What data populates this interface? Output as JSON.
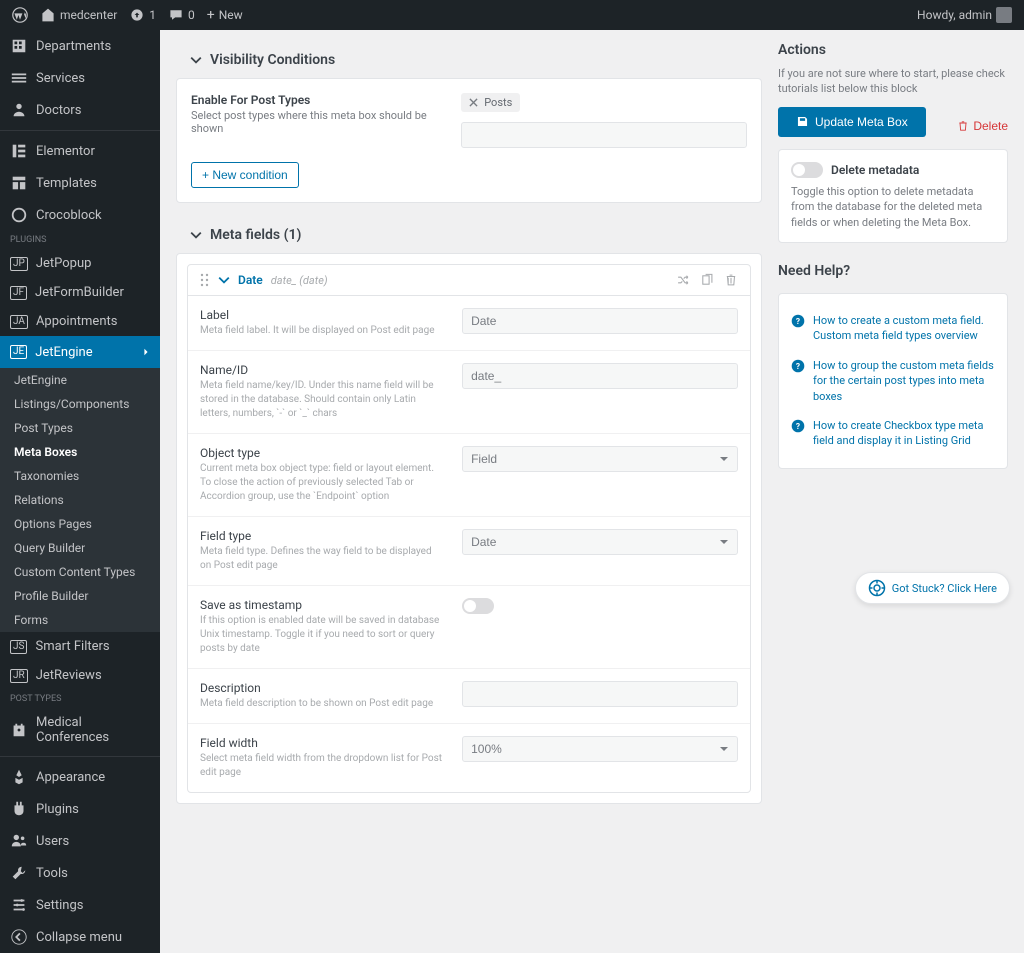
{
  "adminbar": {
    "site": "medcenter",
    "updates": "1",
    "comments": "0",
    "new": "New",
    "howdy": "Howdy, admin"
  },
  "sidebar": {
    "items": [
      {
        "label": "Departments",
        "icon": "building"
      },
      {
        "label": "Services",
        "icon": "layers"
      },
      {
        "label": "Doctors",
        "icon": "user"
      }
    ],
    "items2": [
      {
        "label": "Elementor",
        "icon": "elementor"
      },
      {
        "label": "Templates",
        "icon": "templates"
      },
      {
        "label": "Crocoblock",
        "icon": "croco"
      }
    ],
    "pluginsLabel": "PLUGINS",
    "jet": [
      {
        "label": "JetPopup"
      },
      {
        "label": "JetFormBuilder"
      },
      {
        "label": "Appointments"
      },
      {
        "label": "JetEngine",
        "active": true
      }
    ],
    "sub": [
      {
        "label": "JetEngine"
      },
      {
        "label": "Listings/Components"
      },
      {
        "label": "Post Types"
      },
      {
        "label": "Meta Boxes",
        "active": true
      },
      {
        "label": "Taxonomies"
      },
      {
        "label": "Relations"
      },
      {
        "label": "Options Pages"
      },
      {
        "label": "Query Builder"
      },
      {
        "label": "Custom Content Types"
      },
      {
        "label": "Profile Builder"
      },
      {
        "label": "Forms"
      }
    ],
    "jet2": [
      {
        "label": "Smart Filters"
      },
      {
        "label": "JetReviews"
      }
    ],
    "postTypesLabel": "POST TYPES",
    "medical": {
      "l1": "Medical",
      "l2": "Conferences"
    },
    "tail": [
      {
        "label": "Appearance",
        "icon": "brush"
      },
      {
        "label": "Plugins",
        "icon": "plug"
      },
      {
        "label": "Users",
        "icon": "users"
      },
      {
        "label": "Tools",
        "icon": "wrench"
      },
      {
        "label": "Settings",
        "icon": "sliders"
      },
      {
        "label": "Collapse menu",
        "icon": "collapse"
      }
    ]
  },
  "visibility": {
    "title": "Visibility Conditions",
    "enableTitle": "Enable For Post Types",
    "enableDesc": "Select post types where this meta box should be shown",
    "tag": "Posts",
    "newCondition": "+ New condition"
  },
  "metafields": {
    "title": "Meta fields (1)",
    "item": {
      "name": "Date",
      "key": "date_ (date)"
    },
    "rows": {
      "label": {
        "t": "Label",
        "d": "Meta field label. It will be displayed on Post edit page",
        "v": "Date"
      },
      "nameid": {
        "t": "Name/ID",
        "d": "Meta field name/key/ID. Under this name field will be stored in the database. Should contain only Latin letters, numbers, `-` or `_` chars",
        "v": "date_"
      },
      "objtype": {
        "t": "Object type",
        "d": "Current meta box object type: field or layout element. To close the action of previously selected Tab or Accordion group, use the `Endpoint` option",
        "v": "Field"
      },
      "fieldtype": {
        "t": "Field type",
        "d": "Meta field type. Defines the way field to be displayed on Post edit page",
        "v": "Date"
      },
      "timestamp": {
        "t": "Save as timestamp",
        "d": "If this option is enabled date will be saved in database Unix timestamp. Toggle it if you need to sort or query posts by date"
      },
      "desc": {
        "t": "Description",
        "d": "Meta field description to be shown on Post edit page"
      },
      "width": {
        "t": "Field width",
        "d": "Select meta field width from the dropdown list for Post edit page",
        "v": "100%"
      }
    }
  },
  "actions": {
    "title": "Actions",
    "note": "If you are not sure where to start, please check tutorials list below this block",
    "update": "Update Meta Box",
    "delete": "Delete",
    "deleteMeta": "Delete metadata",
    "deleteMetaDesc": "Toggle this option to delete metadata from the database for the deleted meta fields or when deleting the Meta Box."
  },
  "help": {
    "title": "Need Help?",
    "links": [
      "How to create a custom meta field. Custom meta field types overview",
      "How to group the custom meta fields for the certain post types into meta boxes",
      "How to create Checkbox type meta field and display it in Listing Grid"
    ]
  },
  "floatHelp": "Got Stuck? Click Here"
}
